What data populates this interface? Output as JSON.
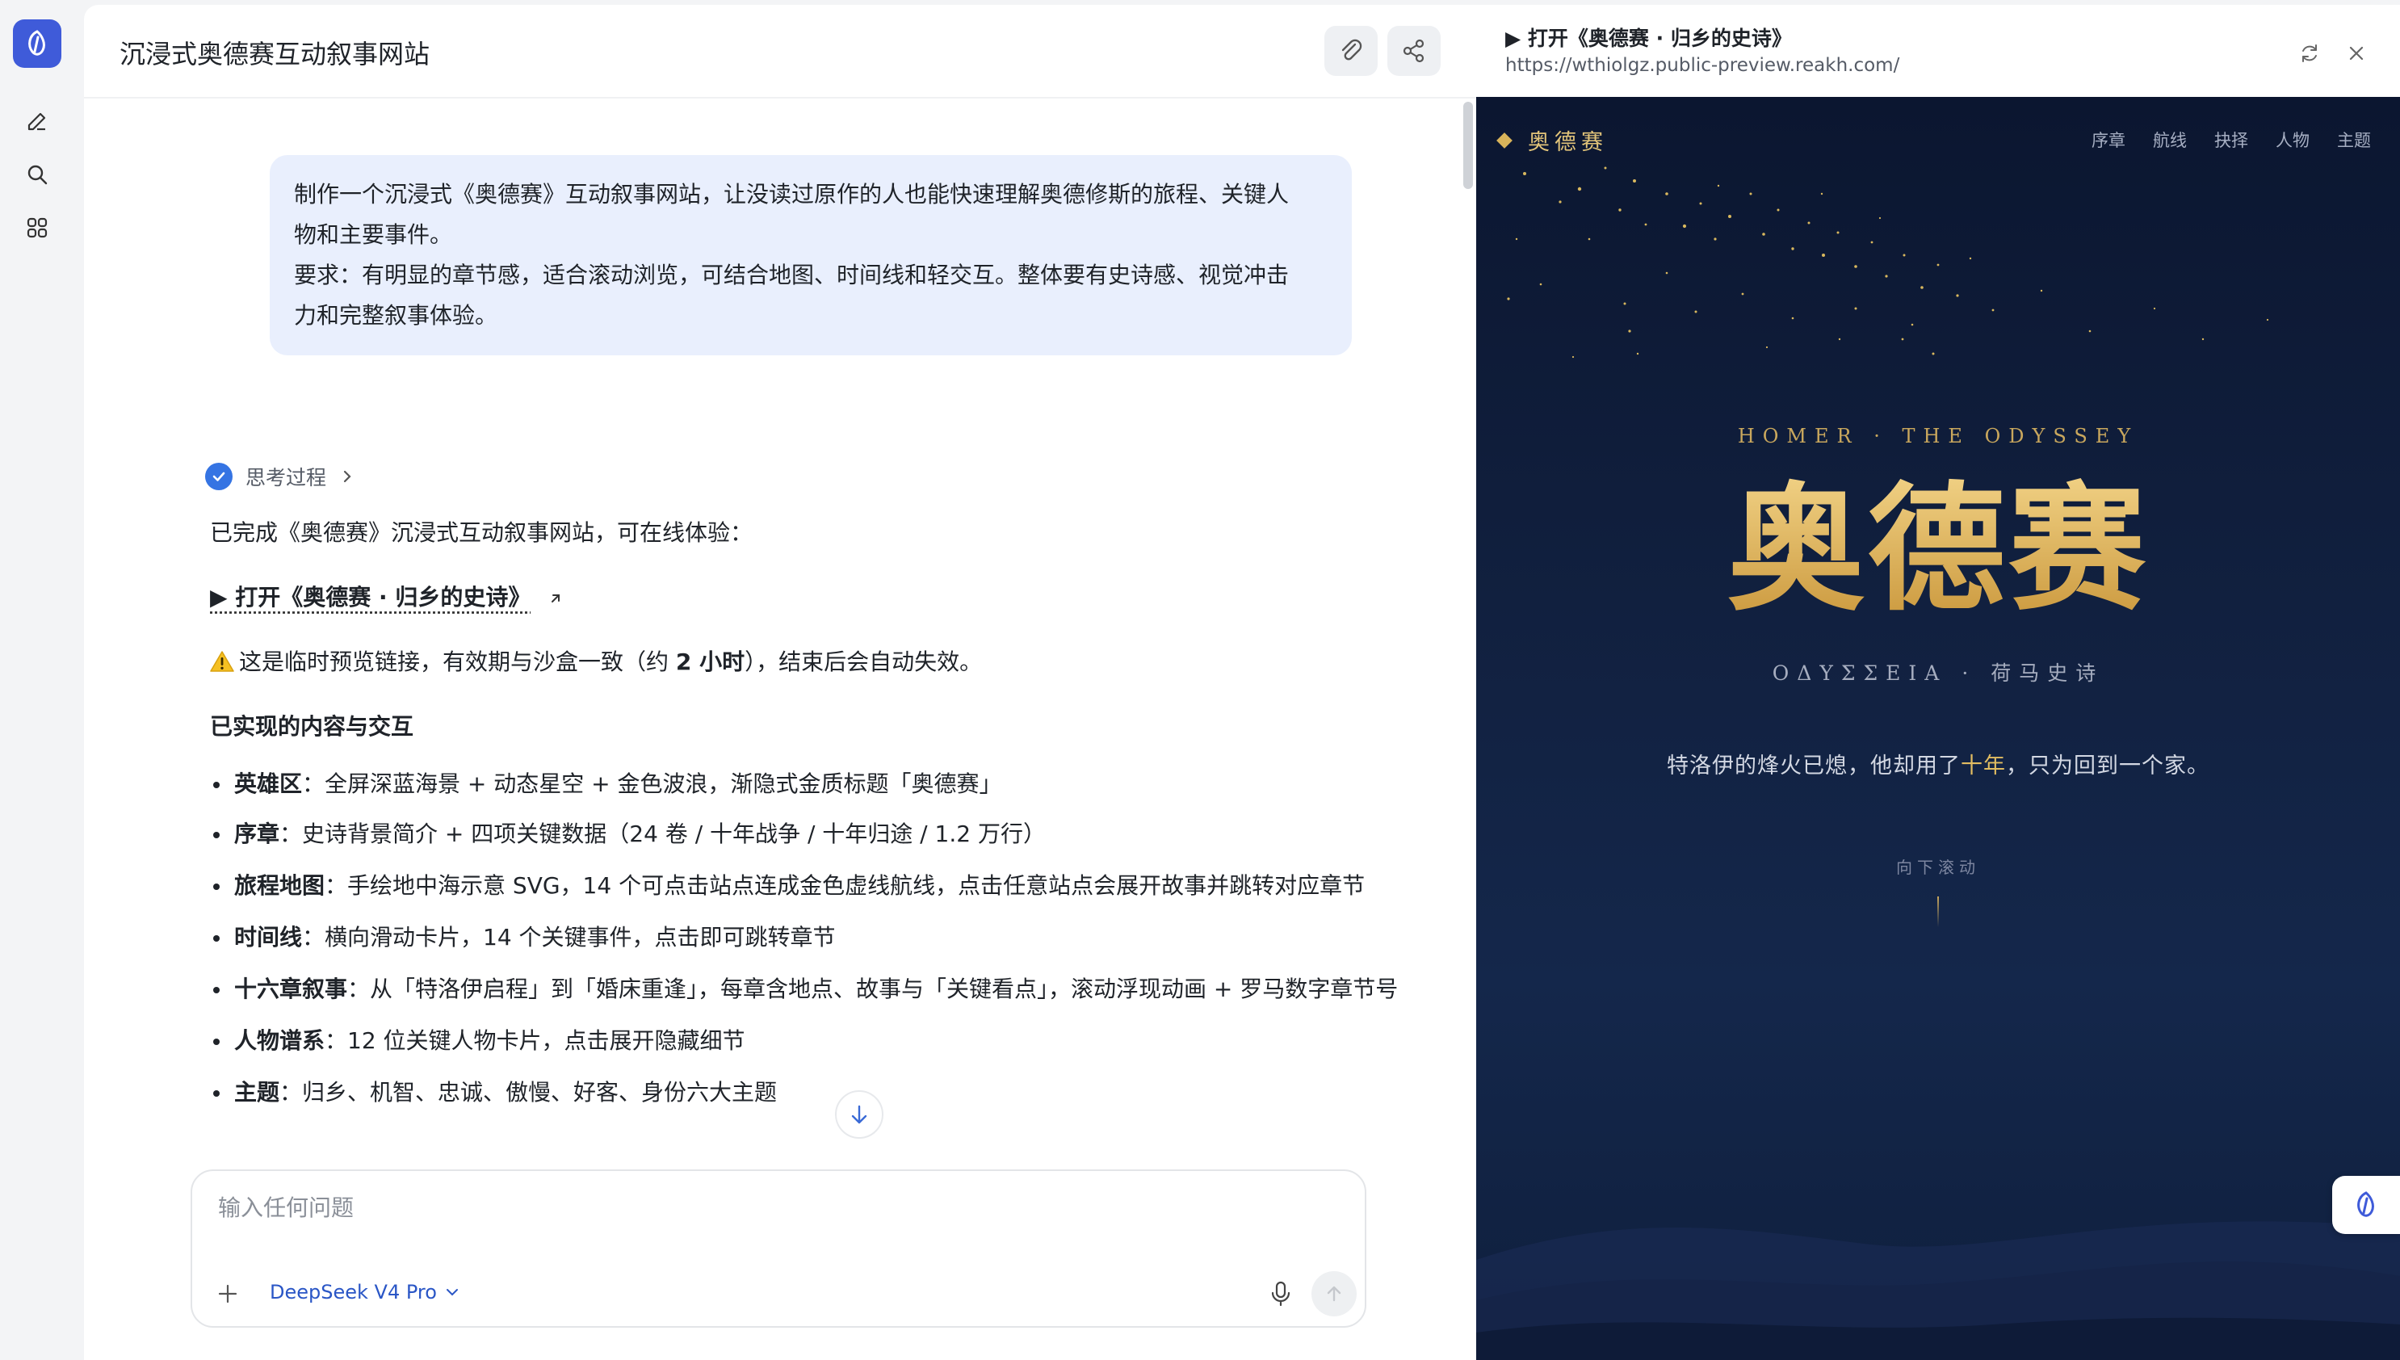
{
  "chat": {
    "title": "沉浸式奥德赛互动叙事网站",
    "user_message": {
      "line1": "制作一个沉浸式《奥德赛》互动叙事网站，让没读过原作的人也能快速理解奥德修斯的旅程、关键人",
      "line2": "物和主要事件。",
      "line3": "要求：有明显的章节感，适合滚动浏览，可结合地图、时间线和轻交互。整体要有史诗感、视觉冲击",
      "line4": "力和完整叙事体验。"
    },
    "thinking_label": "思考过程",
    "reply": {
      "intro": "已完成《奥德赛》沉浸式互动叙事网站，可在线体验：",
      "link_text": "▶ 打开《奥德赛 · 归乡的史诗》",
      "warning_pre": "这是临时预览链接，有效期与沙盒一致（约 ",
      "warning_bold": "2 小时",
      "warning_post": "），结束后会自动失效。",
      "section_title": "已实现的内容与交互",
      "items": [
        {
          "label": "英雄区",
          "text": "：全屏深蓝海景 + 动态星空 + 金色波浪，渐隐式金质标题「奥德赛」"
        },
        {
          "label": "序章",
          "text": "：史诗背景简介 + 四项关键数据（24 卷 / 十年战争 / 十年归途 / 1.2 万行）"
        },
        {
          "label": "旅程地图",
          "text": "：手绘地中海示意 SVG，14 个可点击站点连成金色虚线航线，点击任意站点会展开故事并跳转对应章节"
        },
        {
          "label": "时间线",
          "text": "：横向滑动卡片，14 个关键事件，点击即可跳转章节"
        },
        {
          "label": "十六章叙事",
          "text": "：从「特洛伊启程」到「婚床重逢」，每章含地点、故事与「关键看点」，滚动浮现动画 + 罗马数字章节号"
        },
        {
          "label": "人物谱系",
          "text": "：12 位关键人物卡片，点击展开隐藏细节"
        },
        {
          "label": "主题",
          "text": "：归乡、机智、忠诚、傲慢、好客、身份六大主题"
        }
      ]
    },
    "input": {
      "placeholder": "输入任何问题",
      "model": "DeepSeek V4 Pro"
    }
  },
  "preview": {
    "title": "▶ 打开《奥德赛 · 归乡的史诗》",
    "url": "https://wthiolgz.public-preview.reakh.com/",
    "site": {
      "brand": "奥德赛",
      "nav": [
        "序章",
        "航线",
        "抉择",
        "人物",
        "主题"
      ],
      "kicker": "HOMER · THE ODYSSEY",
      "hero_title": "奥德赛",
      "subtitle": "ΟΔΥΣΣΕΙΑ · 荷马史诗",
      "tagline_pre": "特洛伊的烽火已熄，他却用了",
      "tagline_hl": "十年",
      "tagline_post": "，只为回到一个家。",
      "scroll_hint": "向下滚动"
    }
  },
  "colors": {
    "accent": "#3574e3",
    "bubble": "#e9effd",
    "gold": "#d8b257",
    "night": "#11203f"
  },
  "icons": [
    "app-logo-icon",
    "edit-icon",
    "search-icon",
    "apps-icon",
    "attach-icon",
    "share-icon",
    "check-icon",
    "chevron-right-icon",
    "external-link-icon",
    "warning-icon",
    "arrow-down-icon",
    "plus-icon",
    "chevron-down-icon",
    "mic-icon",
    "send-icon",
    "refresh-icon",
    "close-icon"
  ]
}
